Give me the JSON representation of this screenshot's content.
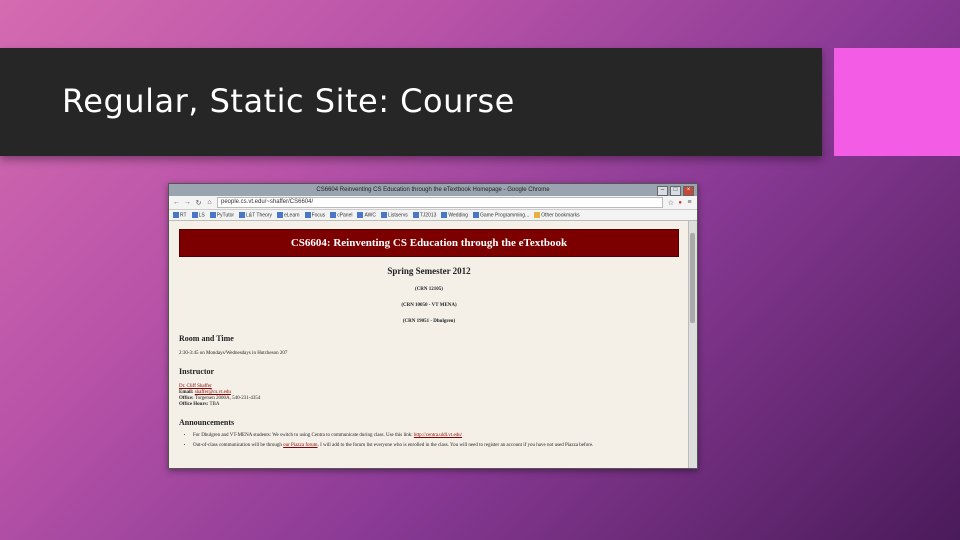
{
  "slide": {
    "title": "Regular, Static Site: Course"
  },
  "browser": {
    "window_title": "CS6604 Reinventing CS Education through the eTextbook Homepage - Google Chrome",
    "url": "people.cs.vt.edu/~shaffer/CS6604/",
    "bookmarks": [
      "RT",
      "LS",
      "PyTutor",
      "L&T Theory",
      "eLearn",
      "Focus",
      "cPanel",
      "AWC",
      "Listservs",
      "TJ2013",
      "Wedding",
      "Game Programming...",
      "Other bookmarks"
    ]
  },
  "page": {
    "banner": "CS6604: Reinventing CS Education through the eTextbook",
    "semester": "Spring Semester 2012",
    "crns": [
      "(CRN 12105)",
      "(CRN 10050 - VT MENA)",
      "(CRN 19051 - Dhulgren)"
    ],
    "room_heading": "Room and Time",
    "room_text": "2:30-3:45 on Mondays/Wednesdays in Hutcheson 207",
    "instructor_heading": "Instructor",
    "instructor_name": "Dr. Cliff Shaffer",
    "email_label": "Email:",
    "email_value": "shaffer@cs.vt.edu",
    "office_label": "Office:",
    "office_value": "Torgersen 2000A, 540-231-4354",
    "hours_label": "Office Hours:",
    "hours_value": "TBA",
    "announcements_heading": "Announcements",
    "ann1_text": "For Dhulgren and VT-MENA students: We switch to using Centra to communicate during class. Use this link:",
    "ann1_link": "http://centra.uldl.vt.edu/",
    "ann2_pre": "Out-of-class communication will be through",
    "ann2_link": "our Piazza forum",
    "ann2_post": ". I will add to the forum list everyone who is enrolled in the class. You will need to register an account if you have not used Piazza before."
  }
}
